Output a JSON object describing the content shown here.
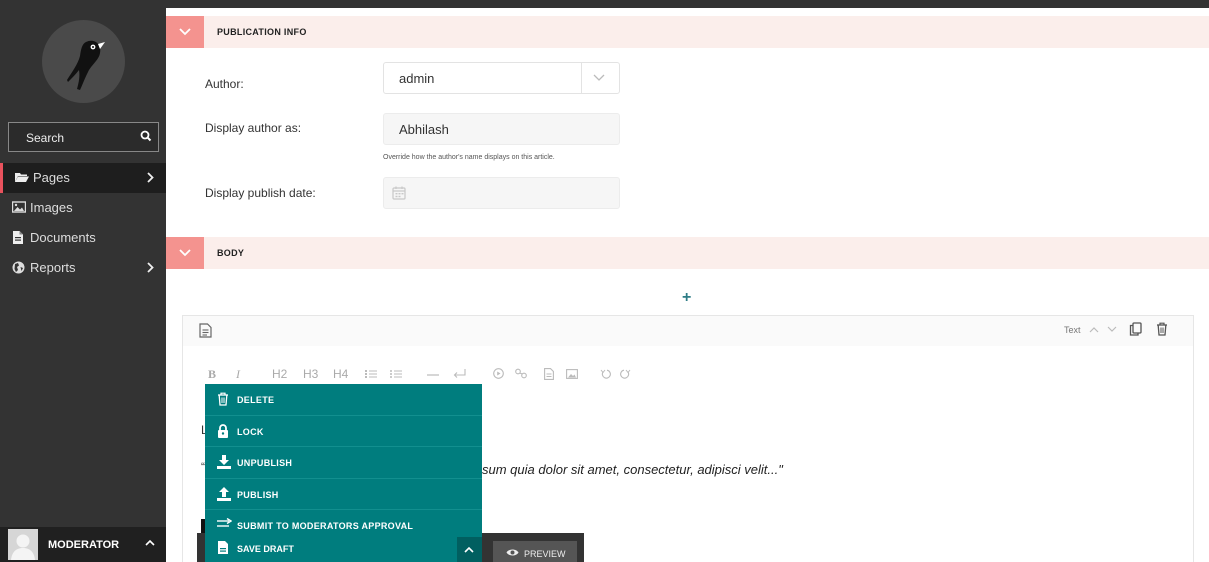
{
  "sidebar": {
    "search_placeholder": "Search",
    "nav": [
      {
        "label": "Pages",
        "icon": "folder-open-icon"
      },
      {
        "label": "Images",
        "icon": "image-icon"
      },
      {
        "label": "Documents",
        "icon": "document-icon"
      },
      {
        "label": "Reports",
        "icon": "globe-icon"
      }
    ],
    "user_name": "MODERATOR"
  },
  "publication": {
    "title": "PUBLICATION INFO",
    "author_label": "Author:",
    "author_value": "admin",
    "display_author_label": "Display author as:",
    "display_author_value": "Abhilash",
    "display_author_help": "Override how the author's name displays on this article.",
    "publish_date_label": "Display publish date:"
  },
  "body_section": {
    "title": "BODY",
    "add_glyph": "+",
    "block_type": "Text",
    "toolbar": {
      "bold": "B",
      "italic": "I",
      "h2": "H2",
      "h3": "H3",
      "h4": "H4"
    },
    "fragment_l": "L",
    "fragment_q": "“",
    "quote_text": "sum quia dolor sit amet, consectetur, adipisci velit...\""
  },
  "action_menu": {
    "items": [
      {
        "label": "DELETE",
        "icon": "trash-icon"
      },
      {
        "label": "LOCK",
        "icon": "lock-icon"
      },
      {
        "label": "UNPUBLISH",
        "icon": "download-icon"
      },
      {
        "label": "PUBLISH",
        "icon": "upload-icon"
      },
      {
        "label": "SUBMIT TO MODERATORS APPROVAL",
        "icon": "arrow-right-icon"
      }
    ],
    "save_label": "SAVE DRAFT",
    "preview_label": "PREVIEW"
  },
  "colors": {
    "accent_teal": "#007d7e",
    "section_bg": "#fbeeeb",
    "section_toggle": "#f4938f",
    "sidebar_bg": "#333333"
  }
}
